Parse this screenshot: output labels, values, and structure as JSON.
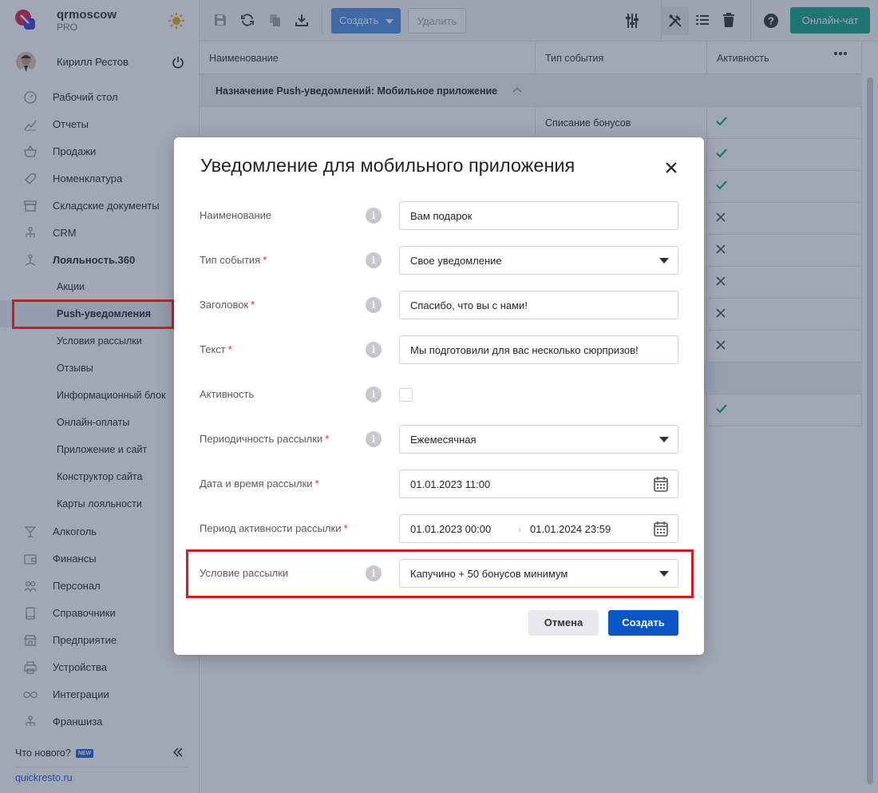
{
  "brand": {
    "name": "qrmoscow",
    "plan": "PRO"
  },
  "user": {
    "name": "Кирилл Рестов"
  },
  "nav": {
    "items": [
      {
        "label": "Рабочий стол",
        "icon": "dashboard-icon"
      },
      {
        "label": "Отчеты",
        "icon": "chart-icon"
      },
      {
        "label": "Продажи",
        "icon": "basket-icon"
      },
      {
        "label": "Номенклатура",
        "icon": "tag-icon"
      },
      {
        "label": "Складские документы",
        "icon": "archive-icon"
      },
      {
        "label": "CRM",
        "icon": "hierarchy-icon"
      },
      {
        "label": "Лояльность.360",
        "icon": "loyalty-icon"
      }
    ],
    "subitems": [
      {
        "label": "Акции"
      },
      {
        "label": "Push-уведомления"
      },
      {
        "label": "Условия рассылки"
      },
      {
        "label": "Отзывы"
      },
      {
        "label": "Информационный блок"
      },
      {
        "label": "Онлайн-оплаты"
      },
      {
        "label": "Приложение и сайт"
      },
      {
        "label": "Конструктор сайта"
      },
      {
        "label": "Карты лояльности"
      }
    ],
    "items2": [
      {
        "label": "Алкоголь",
        "icon": "glass-icon"
      },
      {
        "label": "Финансы",
        "icon": "wallet-icon"
      },
      {
        "label": "Персонал",
        "icon": "people-icon"
      },
      {
        "label": "Справочники",
        "icon": "book-icon"
      },
      {
        "label": "Предприятие",
        "icon": "store-icon"
      },
      {
        "label": "Устройства",
        "icon": "printer-icon"
      },
      {
        "label": "Интеграции",
        "icon": "infinity-icon"
      },
      {
        "label": "Франшиза",
        "icon": "hierarchy-icon"
      }
    ]
  },
  "footer": {
    "whats_new": "Что нового?",
    "new_badge": "NEW",
    "site": "quickresto.ru"
  },
  "toolbar": {
    "create": "Создать",
    "delete": "Удалить",
    "chat": "Онлайн-чат"
  },
  "table": {
    "headers": [
      "Наименование",
      "Тип события",
      "Активность"
    ],
    "group": "Назначение Push-уведомлений: Мобильное приложение",
    "rows": [
      {
        "type": "Списание бонусов",
        "active": true
      },
      {
        "type": "",
        "active": true
      },
      {
        "type": "",
        "active": true
      },
      {
        "type": "",
        "active": false
      },
      {
        "type": "",
        "active": false
      },
      {
        "type": "",
        "active": false
      },
      {
        "type": "",
        "active": false
      },
      {
        "type": "",
        "active": false
      }
    ],
    "last_row_active": true
  },
  "modal": {
    "title": "Уведомление для мобильного приложения",
    "fields": {
      "name": {
        "label": "Наименование",
        "value": "Вам подарок"
      },
      "event": {
        "label": "Тип события",
        "value": "Свое уведомление"
      },
      "header": {
        "label": "Заголовок",
        "value": "Спасибо, что вы с нами!"
      },
      "text": {
        "label": "Текст",
        "value": "Мы подготовили для вас несколько сюрпризов!"
      },
      "active": {
        "label": "Активность"
      },
      "period": {
        "label": "Периодичность рассылки",
        "value": "Ежемесячная"
      },
      "datetime": {
        "label": "Дата и время рассылки",
        "value": "01.01.2023 11:00"
      },
      "activity": {
        "label": "Период активности рассылки",
        "from": "01.01.2023 00:00",
        "to": "01.01.2024 23:59"
      },
      "condition": {
        "label": "Условие рассылки",
        "value": "Капучино + 50 бонусов минимум"
      }
    },
    "cancel": "Отмена",
    "submit": "Создать"
  },
  "colors": {
    "accent": "#0b56c7",
    "chat": "#13a089",
    "highlight": "#e0141d",
    "check": "#13a089"
  }
}
